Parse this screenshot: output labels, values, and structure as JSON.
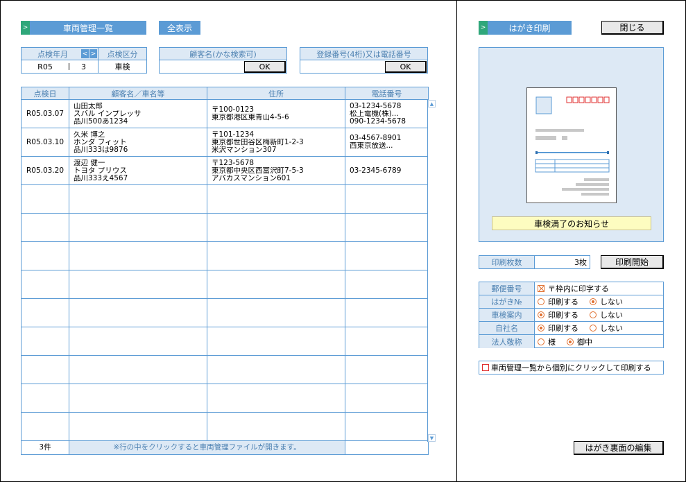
{
  "left": {
    "title": "車両管理一覧",
    "show_all": "全表示",
    "filter": {
      "year_month_label": "点検年月",
      "category_label": "点検区分",
      "era": "R05",
      "month": "3",
      "category": "車検",
      "customer_label": "顧客名(かな検索可)",
      "customer_ok": "OK",
      "reg_label": "登録番号(4桁)又は電話番号",
      "reg_ok": "OK"
    },
    "table": {
      "headers": [
        "点検日",
        "顧客名／車名等",
        "住所",
        "電話番号"
      ],
      "rows": [
        {
          "date": "R05.03.07",
          "name": [
            "山田太郎",
            "スバル インプレッサ",
            "品川500あ1234"
          ],
          "addr": [
            "〒100-0123",
            "東京都港区東青山4-5-6",
            ""
          ],
          "tel": [
            "03-1234-5678",
            "松上電機(株)...",
            "090-1234-5678"
          ]
        },
        {
          "date": "R05.03.10",
          "name": [
            "久米 博之",
            "ホンダ フィット",
            "品川333は9876"
          ],
          "addr": [
            "〒101-1234",
            "東京都世田谷区梅新町1-2-3",
            "米沢マンション307"
          ],
          "tel": [
            "03-4567-8901",
            "西東京放送...",
            ""
          ]
        },
        {
          "date": "R05.03.20",
          "name": [
            "渡辺 健一",
            "トヨタ プリウス",
            "品川333え4567"
          ],
          "addr": [
            "〒123-5678",
            "東京都中央区西富沢町7-5-3",
            "アパカスマンション601"
          ],
          "tel": [
            "03-2345-6789",
            "",
            ""
          ]
        }
      ],
      "empty_rows": 9,
      "count": "3件",
      "footer_note": "※行の中をクリックすると車両管理ファイルが開きます。"
    }
  },
  "right": {
    "title": "はがき印刷",
    "close": "閉じる",
    "notice": "車検満了のお知らせ",
    "print_count_label": "印刷枚数",
    "print_count": "3枚",
    "print_start": "印刷開始",
    "options": [
      {
        "label": "郵便番号",
        "kind": "check",
        "items": [
          {
            "text": "〒枠内に印字する",
            "on": true
          }
        ]
      },
      {
        "label": "はがき№",
        "kind": "radio",
        "items": [
          {
            "text": "印刷する",
            "on": false
          },
          {
            "text": "しない",
            "on": true
          }
        ]
      },
      {
        "label": "車検案内",
        "kind": "radio",
        "items": [
          {
            "text": "印刷する",
            "on": true
          },
          {
            "text": "しない",
            "on": false
          }
        ]
      },
      {
        "label": "自社名",
        "kind": "radio",
        "items": [
          {
            "text": "印刷する",
            "on": true
          },
          {
            "text": "しない",
            "on": false
          }
        ]
      },
      {
        "label": "法人敬称",
        "kind": "radio",
        "items": [
          {
            "text": "様",
            "on": false
          },
          {
            "text": "御中",
            "on": true
          }
        ]
      }
    ],
    "individual_print": "車両管理一覧から個別にクリックして印刷する",
    "edit_back": "はがき裏面の編集"
  },
  "icons": {
    "arrow": "chevron-right-icon",
    "prev": "chevron-left-icon",
    "next": "chevron-right-icon"
  }
}
